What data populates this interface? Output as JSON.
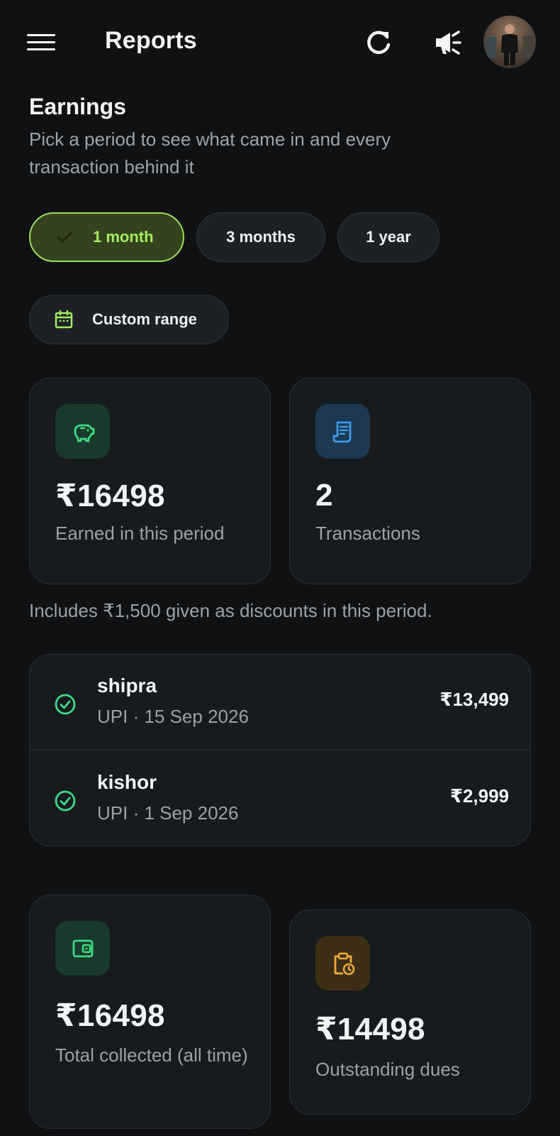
{
  "header": {
    "title": "Reports",
    "menu_icon": "hamburger-menu-icon",
    "refresh_icon": "refresh-icon",
    "announce_icon": "megaphone-icon",
    "avatar_icon": "user-avatar"
  },
  "earnings": {
    "title": "Earnings",
    "subtitle": "Pick a period to see what came in and every transaction behind it"
  },
  "periods": {
    "options": [
      "1 month",
      "3 months",
      "1 year"
    ],
    "selected": "1 month",
    "custom_label": "Custom range"
  },
  "summary": {
    "earned_value": "₹16498",
    "earned_label": "Earned in this period",
    "txn_count": "2",
    "txn_label": "Transactions",
    "discount_note": "Includes ₹1,500 given as discounts in this period."
  },
  "transactions": [
    {
      "name": "shipra",
      "meta": "UPI · 15 Sep 2026",
      "amount": "₹13,499",
      "status_icon": "check-circle-icon"
    },
    {
      "name": "kishor",
      "meta": "UPI · 1 Sep 2026",
      "amount": "₹2,999",
      "status_icon": "check-circle-icon"
    }
  ],
  "totals": {
    "collected_value": "₹16498",
    "collected_label": "Total collected (all time)",
    "dues_value": "₹14498",
    "dues_label": "Outstanding dues"
  },
  "colors": {
    "background": "#0f1113",
    "card": "#171b1e",
    "accent_green": "#9be05a",
    "success_green": "#3ddc84",
    "info_blue": "#3f9be8",
    "warning_amber": "#f0a93a"
  }
}
